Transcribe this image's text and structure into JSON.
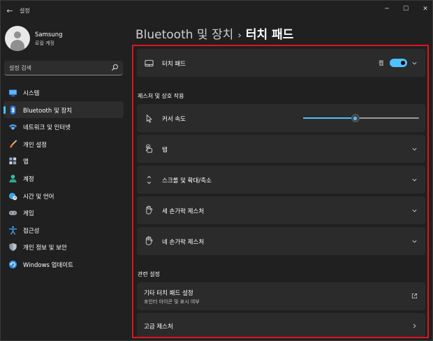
{
  "window": {
    "app_title": "설정",
    "back_glyph": "←",
    "minimize_glyph": "─",
    "maximize_glyph": "☐",
    "close_glyph": "✕"
  },
  "profile": {
    "name": "Samsung",
    "account_type": "로컬 계정"
  },
  "search": {
    "placeholder": "설정 검색"
  },
  "sidebar": {
    "accent_color": "#4cc2ff",
    "items": [
      {
        "label": "시스템",
        "icon": "monitor-icon",
        "active": false
      },
      {
        "label": "Bluetooth 및 장치",
        "icon": "bluetooth-icon",
        "active": true
      },
      {
        "label": "네트워크 및 인터넷",
        "icon": "wifi-icon",
        "active": false
      },
      {
        "label": "개인 설정",
        "icon": "brush-icon",
        "active": false
      },
      {
        "label": "앱",
        "icon": "apps-icon",
        "active": false
      },
      {
        "label": "계정",
        "icon": "person-icon",
        "active": false
      },
      {
        "label": "시간 및 언어",
        "icon": "globe-clock-icon",
        "active": false
      },
      {
        "label": "게임",
        "icon": "gamepad-icon",
        "active": false
      },
      {
        "label": "접근성",
        "icon": "accessibility-icon",
        "active": false
      },
      {
        "label": "개인 정보 및 보안",
        "icon": "shield-icon",
        "active": false
      },
      {
        "label": "Windows 업데이트",
        "icon": "update-icon",
        "active": false
      }
    ]
  },
  "breadcrumb": {
    "parent": "Bluetooth 및 장치",
    "separator": "›",
    "current": "터치 패드"
  },
  "touchpad_card": {
    "label": "터치 패드",
    "toggle_state": "켬",
    "toggle_on": true
  },
  "gestures_section": {
    "title": "제스처 및 상호 작용",
    "cursor_speed_label": "커서 속도",
    "cursor_speed_value": 0.45,
    "tap_label": "탭",
    "scroll_label": "스크롤 및 확대/축소",
    "three_finger_label": "세 손가락 제스처",
    "four_finger_label": "네 손가락 제스처"
  },
  "related_section": {
    "title": "관련 설정",
    "other_settings_label": "기타 터치 패드 설정",
    "other_settings_sub": "포인터 아이콘 및 표시 여부",
    "advanced_gestures_label": "고급 제스처"
  },
  "highlight_color": "#e0141e"
}
